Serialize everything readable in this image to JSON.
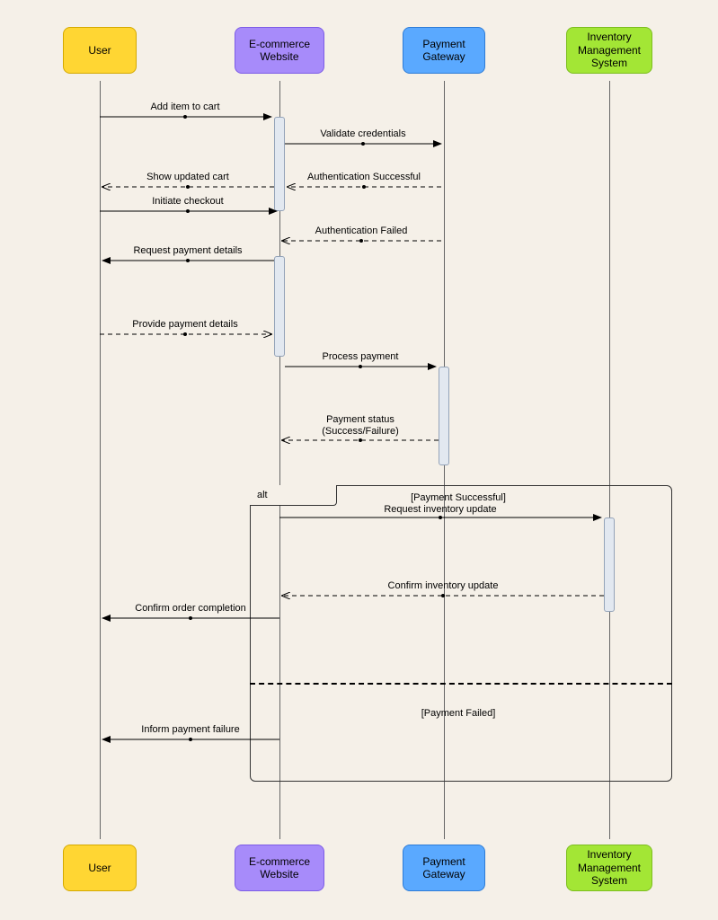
{
  "actors": {
    "user": "User",
    "website": "E-commerce Website",
    "gateway": "Payment Gateway",
    "inventory": "Inventory Management System"
  },
  "messages": {
    "m1": "Add item to cart",
    "m2": "Validate credentials",
    "m3": "Show updated cart",
    "m4": "Authentication Successful",
    "m5": "Initiate checkout",
    "m6": "Authentication Failed",
    "m7": "Request payment details",
    "m8": "Provide payment details",
    "m9": "Process payment",
    "m10a": "Payment status",
    "m10b": "(Success/Failure)",
    "m11": "Request inventory update",
    "m12": "Confirm inventory update",
    "m13": "Confirm order completion",
    "m14": "Inform payment failure"
  },
  "alt": {
    "label": "alt",
    "guard_success": "[Payment Successful]",
    "guard_fail": "[Payment Failed]"
  }
}
